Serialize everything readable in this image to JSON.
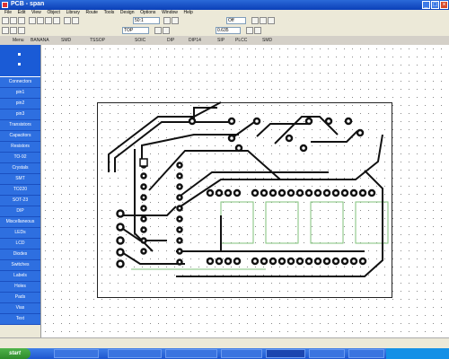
{
  "window": {
    "title": "PCB - span"
  },
  "menu": [
    "File",
    "Edit",
    "View",
    "Object",
    "Library",
    "Route",
    "Tools",
    "Design",
    "Options",
    "Window",
    "Help"
  ],
  "toolbar": {
    "zoom_value": "50:1",
    "grid_value": "Off",
    "layer_value": "TOP",
    "snap_value": "0.635"
  },
  "tabs": [
    "Menu",
    "BANANA",
    "SMD",
    "TSSOP",
    "SOIC",
    "DIP",
    "DIP14",
    "SIP",
    "PLCC",
    "SMD"
  ],
  "sidebar": {
    "items": [
      "Connectors",
      "pin1",
      "pin2",
      "pin3",
      "Transistors",
      "Capacitors",
      "Resistors",
      "TO-92",
      "Crystals",
      "SMT",
      "TO220",
      "SOT-23",
      "DIP",
      "Miscellaneous",
      "LEDs",
      "LCD",
      "Diodes",
      "Switches",
      "Labels",
      "Holes",
      "Pads",
      "Vias",
      "Text"
    ]
  },
  "taskbar": {
    "start": "start",
    "tasks": [
      "",
      "",
      "",
      "",
      "",
      "",
      ""
    ],
    "clock": ""
  },
  "colors": {
    "trace": "#111111",
    "pad": "#111111",
    "ghost": "#7fc27a",
    "board_edge": "#222222"
  }
}
